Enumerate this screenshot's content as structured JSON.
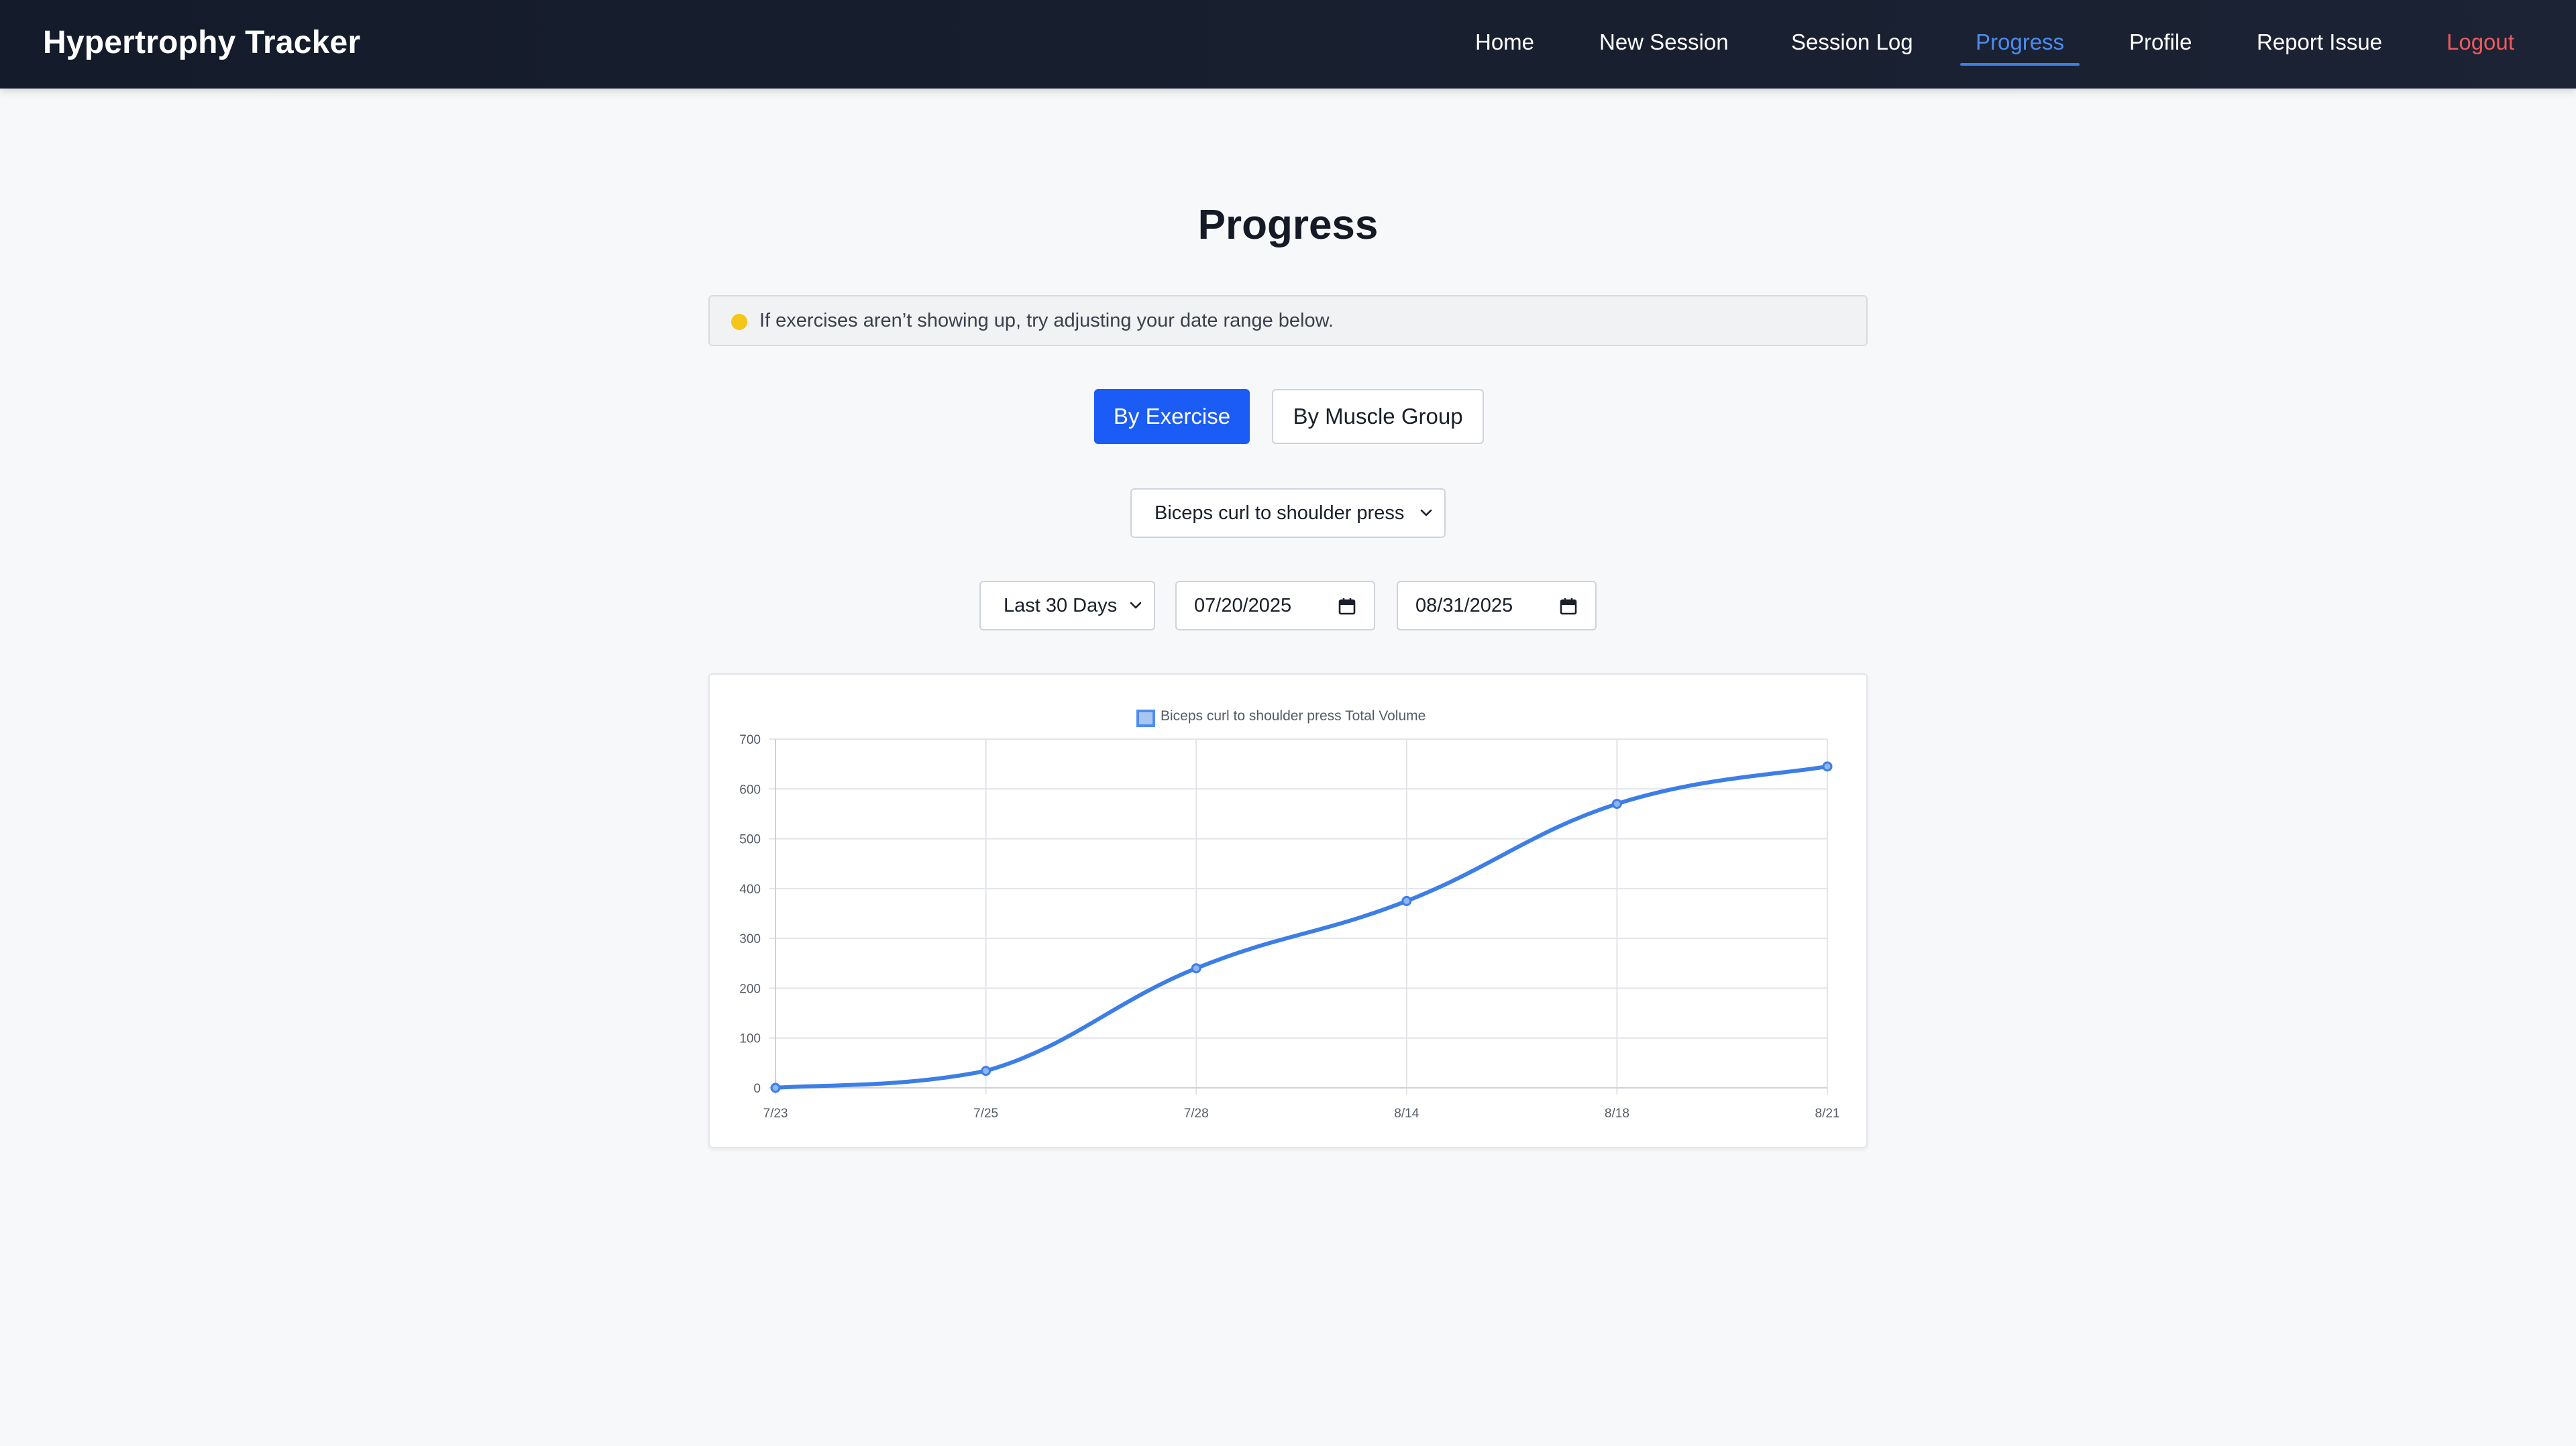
{
  "app": {
    "brand": "Hypertrophy Tracker"
  },
  "nav": {
    "items": [
      {
        "label": "Home",
        "name": "nav-home"
      },
      {
        "label": "New Session",
        "name": "nav-new-session"
      },
      {
        "label": "Session Log",
        "name": "nav-session-log"
      },
      {
        "label": "Progress",
        "name": "nav-progress",
        "active": true
      },
      {
        "label": "Profile",
        "name": "nav-profile"
      },
      {
        "label": "Report Issue",
        "name": "nav-report-issue"
      },
      {
        "label": "Logout",
        "name": "nav-logout"
      }
    ]
  },
  "page": {
    "title": "Progress",
    "notice": "If exercises aren’t showing up, try adjusting your date range below.",
    "notice_icon": "warning-dot-icon"
  },
  "tabs": {
    "by_exercise": "By Exercise",
    "by_muscle_group": "By Muscle Group",
    "active": "By Exercise"
  },
  "filters": {
    "exercise": "Biceps curl to shoulder press",
    "range": "Last 30 Days",
    "start_date": "07/20/2025",
    "end_date": "08/31/2025"
  },
  "colors": {
    "accent": "#1a5cf5",
    "line": "#3d7ee6",
    "nav_active": "#4d8cf0",
    "logout": "#ee5a5f",
    "notice_dot": "#f5c518",
    "navbar": "#141b2a"
  },
  "chart_data": {
    "type": "line",
    "legend": "Biceps curl to shoulder press Total Volume",
    "legend_position": "top-center",
    "categories": [
      "7/23",
      "7/25",
      "7/28",
      "8/14",
      "8/18",
      "8/21"
    ],
    "series": [
      {
        "name": "Biceps curl to shoulder press Total Volume",
        "values": [
          0,
          34,
          240,
          375,
          570,
          645
        ]
      }
    ],
    "ylim": [
      0,
      700
    ],
    "yticks": [
      0,
      100,
      200,
      300,
      400,
      500,
      600,
      700
    ],
    "grid": true,
    "smooth": true
  }
}
